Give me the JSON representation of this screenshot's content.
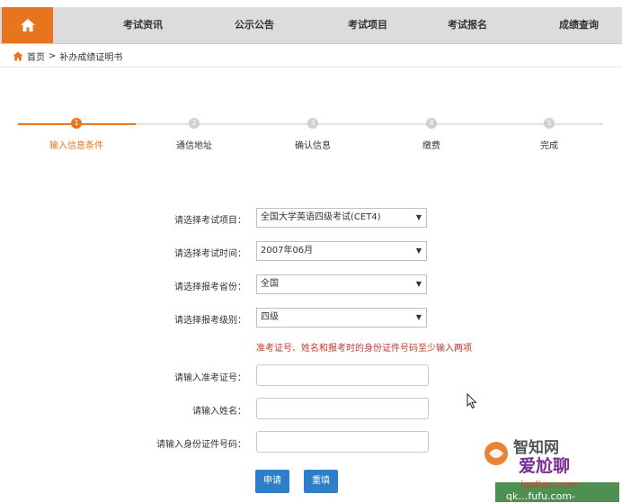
{
  "nav": {
    "home_icon": "home-icon",
    "items": [
      {
        "label": "考试资讯"
      },
      {
        "label": "公示公告"
      },
      {
        "label": "考试项目"
      },
      {
        "label": "考试报名"
      },
      {
        "label": "成绩查询"
      }
    ]
  },
  "breadcrumb": {
    "home": "首页",
    "separator": ">",
    "current": "补办成绩证明书"
  },
  "steps": [
    {
      "number": "1",
      "label": "输入信息条件"
    },
    {
      "number": "2",
      "label": "通信地址"
    },
    {
      "number": "3",
      "label": "确认信息"
    },
    {
      "number": "4",
      "label": "缴费"
    },
    {
      "number": "5",
      "label": "完成"
    }
  ],
  "form": {
    "exam_project": {
      "label": "请选择考试项目：",
      "value": "全国大学英语四级考试(CET4)"
    },
    "exam_time": {
      "label": "请选择考试时间：",
      "value": "2007年06月"
    },
    "province": {
      "label": "请选择报考省份：",
      "value": "全国"
    },
    "level": {
      "label": "请选择报考级别：",
      "value": "四级"
    },
    "warning": "准考证号、姓名和报考时的身份证件号码至少输入两项",
    "ticket_no": {
      "label": "请输入准考证号：",
      "value": ""
    },
    "name": {
      "label": "请输入姓名：",
      "value": ""
    },
    "id_no": {
      "label": "请输入身份证件号码：",
      "value": ""
    },
    "apply_label": "申请",
    "reset_label": "重填"
  },
  "watermark": {
    "line1": "智知网",
    "line2": "爱尬聊",
    "line3": "igaliao.com",
    "line4": "qk…fufu.com-"
  },
  "colors": {
    "accent": "#e8741e",
    "primary_button": "#2f7fc8",
    "warning": "#c0392b",
    "nav_bg": "#dcdcdc"
  }
}
